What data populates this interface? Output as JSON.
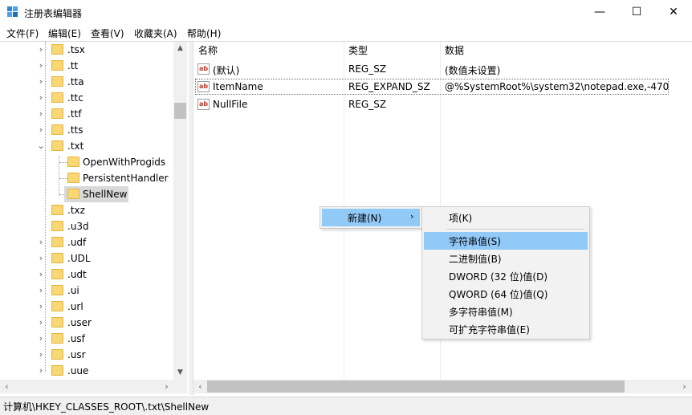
{
  "window": {
    "title": "注册表编辑器",
    "controls": {
      "minimize": "—",
      "maximize": "☐",
      "close": "✕"
    }
  },
  "menubar": [
    "文件(F)",
    "编辑(E)",
    "查看(V)",
    "收藏夹(A)",
    "帮助(H)"
  ],
  "tree": {
    "items": [
      {
        "label": ".tsx",
        "expanded": false
      },
      {
        "label": ".tt",
        "expanded": false
      },
      {
        "label": ".tta",
        "expanded": false
      },
      {
        "label": ".ttc",
        "expanded": false
      },
      {
        "label": ".ttf",
        "expanded": false
      },
      {
        "label": ".tts",
        "expanded": false
      },
      {
        "label": ".txt",
        "expanded": true
      },
      {
        "label": "OpenWithProgids",
        "child": true
      },
      {
        "label": "PersistentHandler",
        "child": true
      },
      {
        "label": "ShellNew",
        "child": true,
        "selected": true
      },
      {
        "label": ".txz",
        "expanded": false
      },
      {
        "label": ".u3d",
        "expanded": false
      },
      {
        "label": ".udf",
        "expanded": false
      },
      {
        "label": ".UDL",
        "expanded": false
      },
      {
        "label": ".udt",
        "expanded": false
      },
      {
        "label": ".ui",
        "expanded": false
      },
      {
        "label": ".url",
        "expanded": false
      },
      {
        "label": ".user",
        "expanded": false
      },
      {
        "label": ".usf",
        "expanded": false
      },
      {
        "label": ".usr",
        "expanded": false
      },
      {
        "label": ".uue",
        "expanded": false
      }
    ]
  },
  "list": {
    "columns": [
      "名称",
      "类型",
      "数据"
    ],
    "rows": [
      {
        "name": "(默认)",
        "type": "REG_SZ",
        "data": "(数值未设置)"
      },
      {
        "name": "ItemName",
        "type": "REG_EXPAND_SZ",
        "data": "@%SystemRoot%\\system32\\notepad.exe,-470"
      },
      {
        "name": "NullFile",
        "type": "REG_SZ",
        "data": ""
      }
    ]
  },
  "context_menu": {
    "main_item": "新建(N)",
    "submenu": [
      "项(K)",
      "字符串值(S)",
      "二进制值(B)",
      "DWORD (32 位)值(D)",
      "QWORD (64 位)值(Q)",
      "多字符串值(M)",
      "可扩充字符串值(E)"
    ],
    "highlighted": "字符串值(S)"
  },
  "status": {
    "path": "计算机\\HKEY_CLASSES_ROOT\\.txt\\ShellNew"
  },
  "colors": {
    "highlight": "#91c9f7",
    "folder": "#f8d775",
    "selection": "#d9d9d9"
  },
  "icons": {
    "app": "registry-editor-icon",
    "value": "string-value-icon",
    "folder": "folder-icon"
  }
}
